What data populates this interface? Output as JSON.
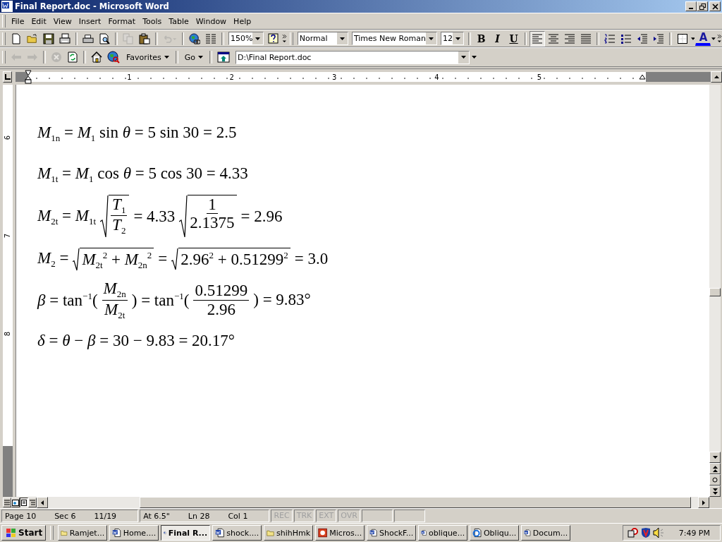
{
  "window": {
    "title": "Final Report.doc - Microsoft Word"
  },
  "menu": [
    "File",
    "Edit",
    "View",
    "Insert",
    "Format",
    "Tools",
    "Table",
    "Window",
    "Help"
  ],
  "standard_toolbar": {
    "buttons_a": [
      {
        "kind": "new",
        "disabled": false
      },
      {
        "kind": "open",
        "disabled": false
      },
      {
        "kind": "save",
        "disabled": false
      },
      {
        "kind": "permission",
        "disabled": false
      },
      {
        "kind": "print",
        "disabled": false
      },
      {
        "kind": "preview",
        "disabled": false
      },
      {
        "kind": "copy",
        "disabled": true
      },
      {
        "kind": "paste",
        "disabled": false
      },
      {
        "kind": "undo",
        "disabled": true
      },
      {
        "kind": "globe",
        "disabled": false
      },
      {
        "kind": "columns",
        "disabled": false
      }
    ],
    "zoom": "150%",
    "style": "Normal",
    "font": "Times New Roman",
    "size": "12",
    "format_buttons": [
      {
        "kind": "bold",
        "label": "B"
      },
      {
        "kind": "italic",
        "label": "I"
      },
      {
        "kind": "underline",
        "label": "U"
      }
    ],
    "alignment_buttons": [
      {
        "kind": "left",
        "selected": true
      },
      {
        "kind": "center",
        "selected": false
      },
      {
        "kind": "right",
        "selected": false
      },
      {
        "kind": "justify",
        "selected": false
      }
    ],
    "font_color_label": "A"
  },
  "web_toolbar": {
    "favorites": "Favorites",
    "go": "Go",
    "address": "D:\\Final Report.doc"
  },
  "ruler": {
    "horizontal_numbers": [
      "1",
      "2",
      "3",
      "4",
      "5"
    ],
    "vertical_numbers": [
      "6",
      "7",
      "8"
    ]
  },
  "equations": [
    {
      "parts": [
        {
          "kind": "text",
          "text": "*M*$_{1n}$ = *M*$_{1}$ sin *θ* = 5 sin 30 = 2.5"
        }
      ]
    },
    {
      "parts": [
        {
          "kind": "text",
          "text": "*M*$_{1t}$ = *M*$_{1}$ cos *θ* = 5 cos 30 = 4.33"
        }
      ]
    },
    {
      "parts": [
        {
          "kind": "text",
          "text": "*M*$_{2t}$ = *M*$_{1t}$"
        },
        {
          "kind": "root_fraction",
          "num": "*T*$_{1}$",
          "den": "*T*$_{2}$"
        },
        {
          "kind": "text",
          "text": "= 4.33"
        },
        {
          "kind": "root_fraction",
          "num": "1",
          "den": "2.1375"
        },
        {
          "kind": "text",
          "text": "= 2.96"
        }
      ]
    },
    {
      "parts": [
        {
          "kind": "text",
          "text": "*M*$_{2}$ ="
        },
        {
          "kind": "root",
          "body": "*M*$_{2t}$$^{2}$ + *M*$_{2n}$$^{2}$"
        },
        {
          "kind": "text",
          "text": "="
        },
        {
          "kind": "root",
          "body": "2.96$^{2}$ + 0.51299$^{2}$"
        },
        {
          "kind": "text",
          "text": "= 3.0"
        }
      ]
    },
    {
      "parts": [
        {
          "kind": "text",
          "text": "*β* = tan$^{−1}$("
        },
        {
          "kind": "fraction",
          "num": "*M*$_{2n}$",
          "den": "*M*$_{2t}$"
        },
        {
          "kind": "text",
          "text": ") = tan$^{−1}$("
        },
        {
          "kind": "fraction",
          "num": "0.51299",
          "den": "2.96"
        },
        {
          "kind": "text",
          "text": ") = 9.83°"
        }
      ]
    },
    {
      "parts": [
        {
          "kind": "text",
          "text": "*δ* = *θ* − *β* = 30 − 9.83 = 20.17°"
        }
      ]
    }
  ],
  "status_bar": {
    "fields": [
      "Page 10",
      "Sec 6",
      "11/19",
      "At 6.5\"",
      "Ln 28",
      "Col 1"
    ],
    "modes": [
      {
        "label": "REC",
        "active": false
      },
      {
        "label": "TRK",
        "active": false
      },
      {
        "label": "EXT",
        "active": false
      },
      {
        "label": "OVR",
        "active": false
      }
    ]
  },
  "taskbar": {
    "start": "Start",
    "items": [
      {
        "label": "Ramjet...",
        "kind": "folder",
        "selected": false
      },
      {
        "label": "Home....",
        "kind": "word",
        "selected": false
      },
      {
        "label": "Final R...",
        "kind": "word",
        "selected": true
      },
      {
        "label": "shock....",
        "kind": "word",
        "selected": false
      },
      {
        "label": "shihHmk",
        "kind": "folder",
        "selected": false
      },
      {
        "label": "Micros...",
        "kind": "powerpoint",
        "selected": false
      },
      {
        "label": "ShockF...",
        "kind": "word",
        "selected": false
      },
      {
        "label": "oblique...",
        "kind": "word",
        "selected": false
      },
      {
        "label": "Obliqu...",
        "kind": "browser",
        "selected": false
      },
      {
        "label": "Docum...",
        "kind": "word",
        "selected": false
      }
    ],
    "clock": "7:49 PM"
  }
}
